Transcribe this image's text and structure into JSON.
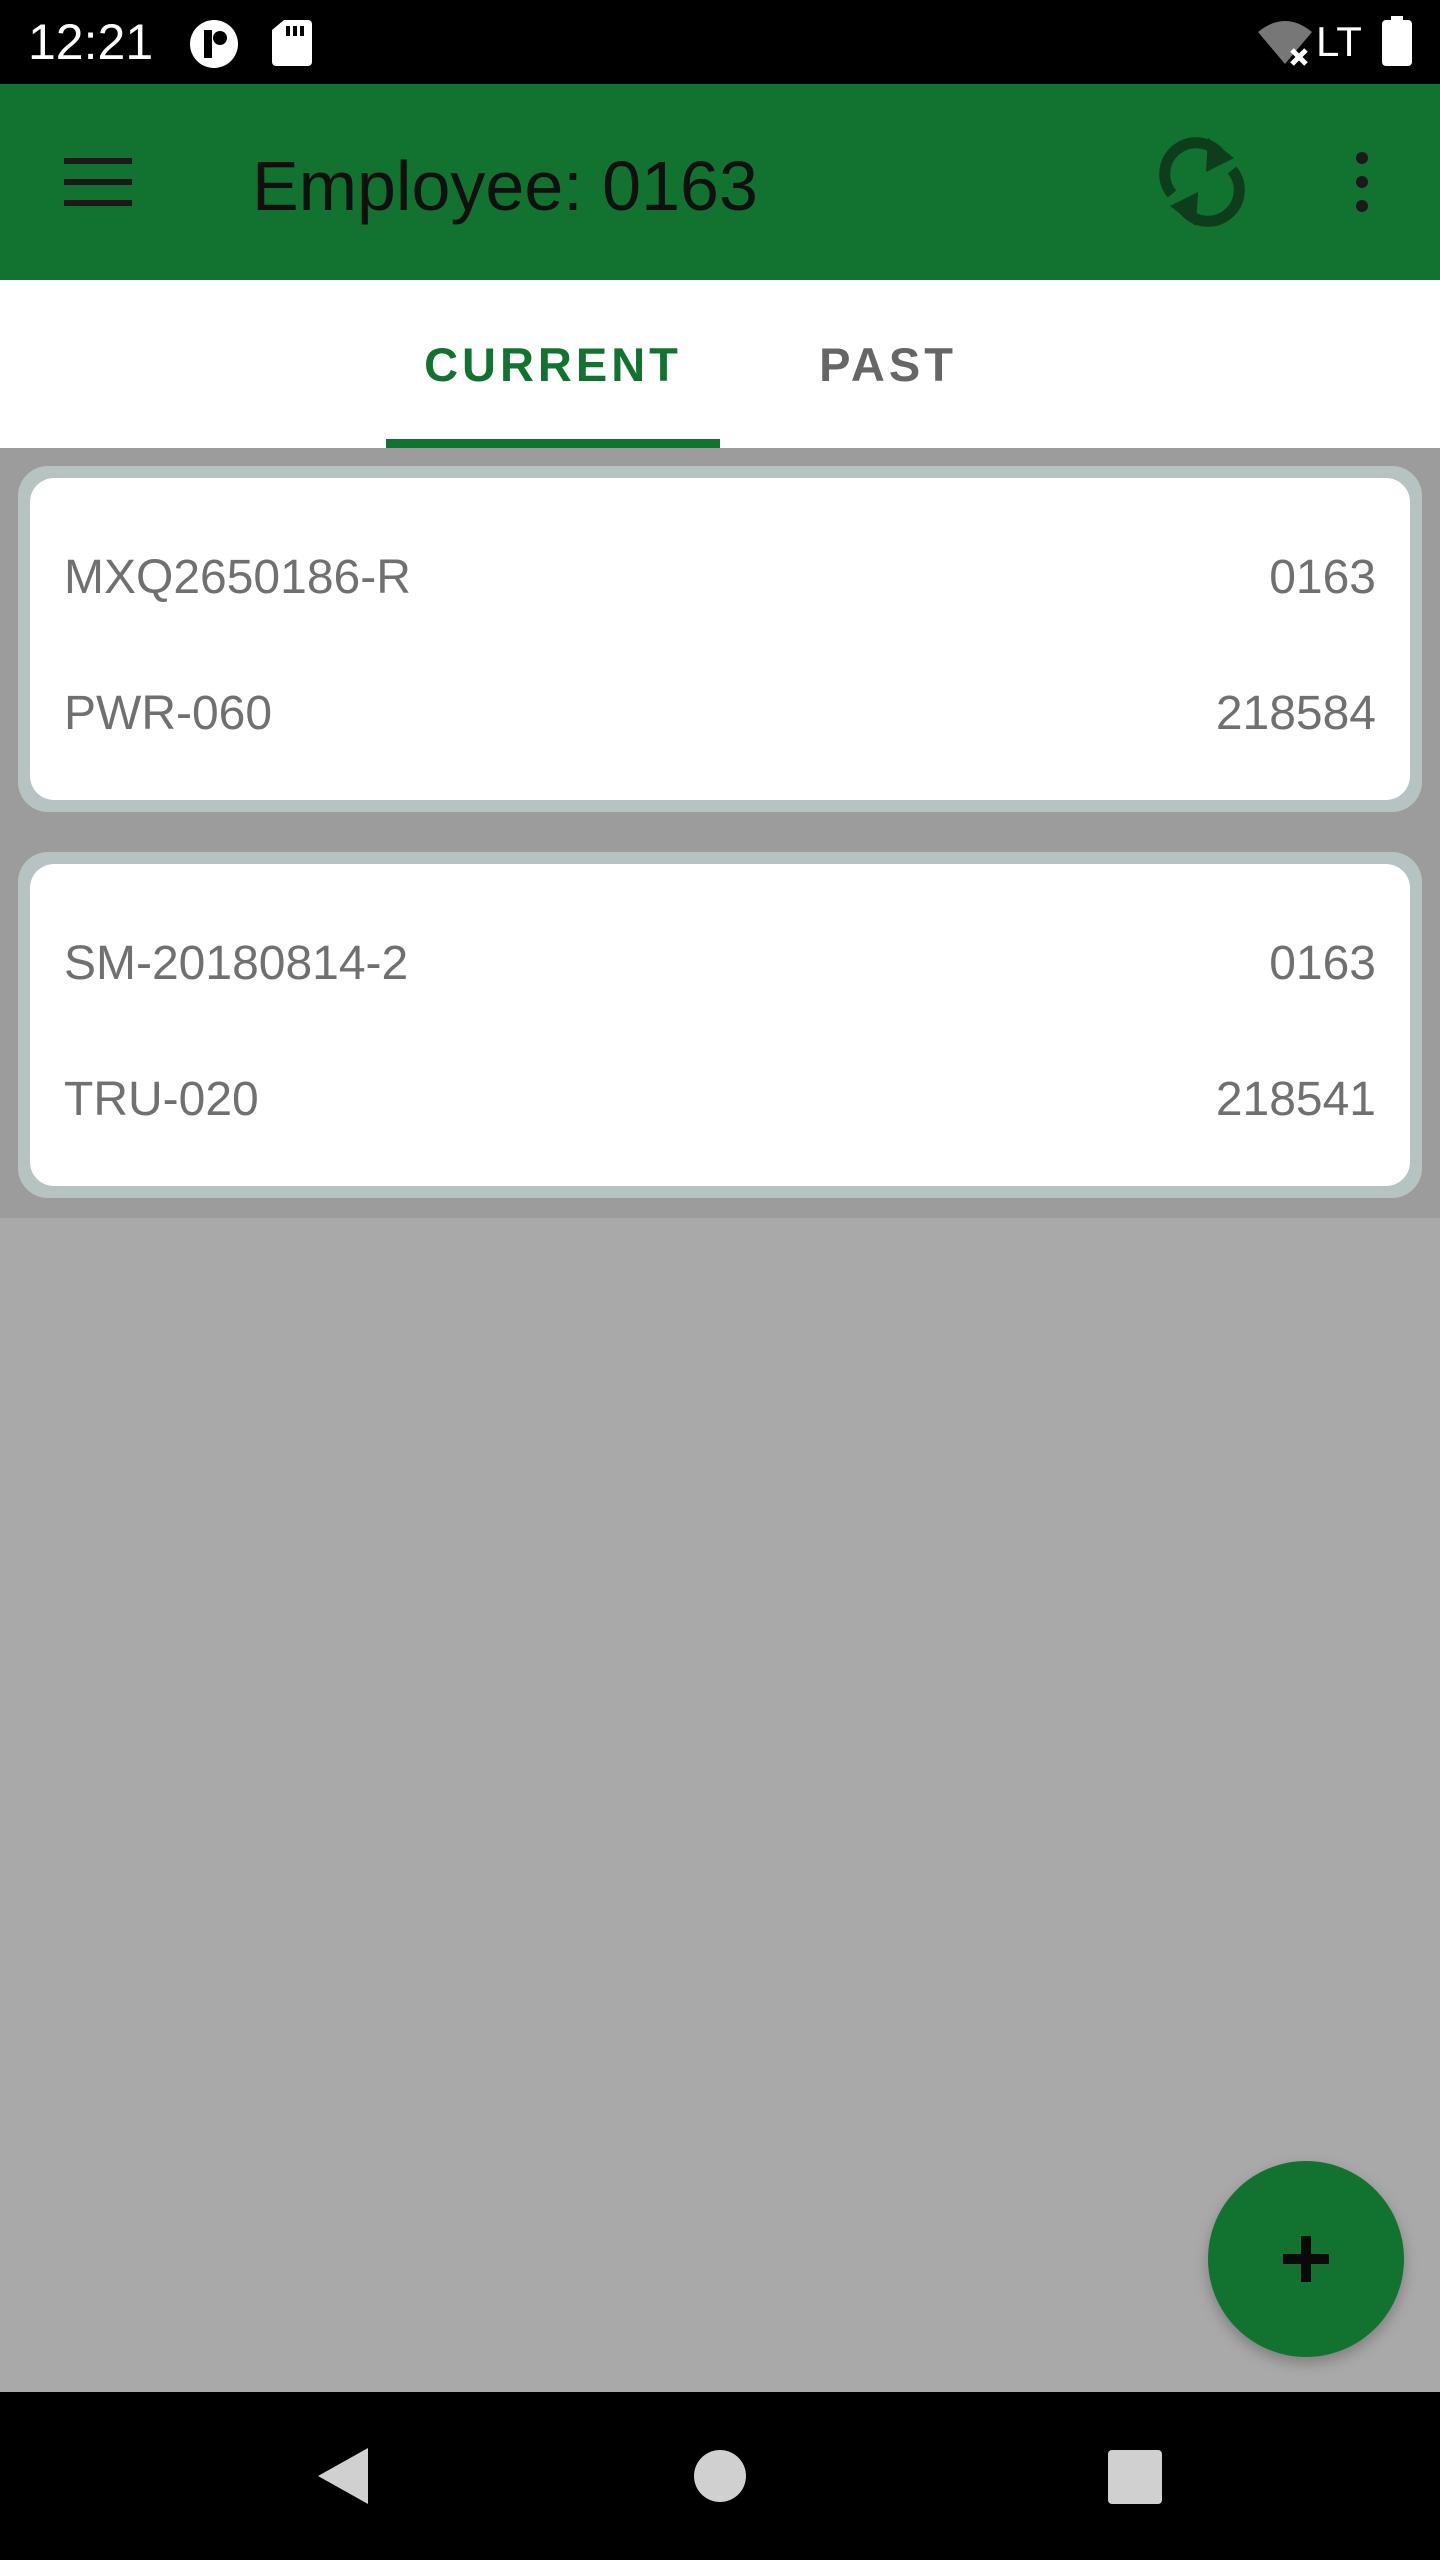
{
  "status_bar": {
    "time": "12:21",
    "network": "LTE",
    "icons": [
      "sync-status-icon",
      "sd-card-icon",
      "wifi-off-icon",
      "battery-icon"
    ]
  },
  "app_bar": {
    "title": "Employee: 0163",
    "icons": [
      "menu-icon",
      "refresh-icon",
      "more-vert-icon"
    ]
  },
  "tabs": [
    {
      "label": "CURRENT",
      "selected": true
    },
    {
      "label": "PAST",
      "selected": false
    }
  ],
  "cards": [
    {
      "id": "MXQ2650186-R",
      "employee": "0163",
      "code": "PWR-060",
      "number": "218584"
    },
    {
      "id": "SM-20180814-2",
      "employee": "0163",
      "code": "TRU-020",
      "number": "218541"
    }
  ],
  "fab": {
    "icon": "add-icon"
  },
  "nav_bar": {
    "icons": [
      "back-icon",
      "home-icon",
      "recents-icon"
    ]
  },
  "colors": {
    "primary": "#127331",
    "status_bar": "#000000",
    "background": "#a9a9a9",
    "card_text": "#707070",
    "tab_inactive": "#666666"
  }
}
